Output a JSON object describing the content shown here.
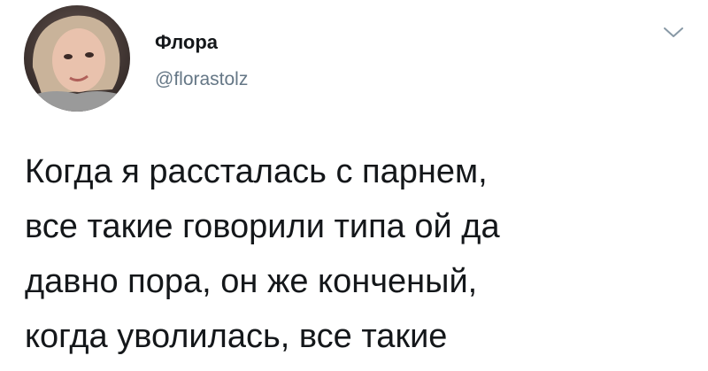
{
  "author": {
    "display_name": "Флора",
    "handle": "@florastolz",
    "avatar_icon": "user-avatar-photo"
  },
  "menu": {
    "icon": "chevron-down-icon"
  },
  "tweet": {
    "text": "Когда я рассталась с парнем,\nвсе такие говорили типа ой да\nдавно пора, он же конченый,\nкогда уволилась, все такие"
  },
  "colors": {
    "name": "#14171a",
    "handle": "#657786",
    "caret": "#8899a6",
    "background": "#ffffff"
  }
}
